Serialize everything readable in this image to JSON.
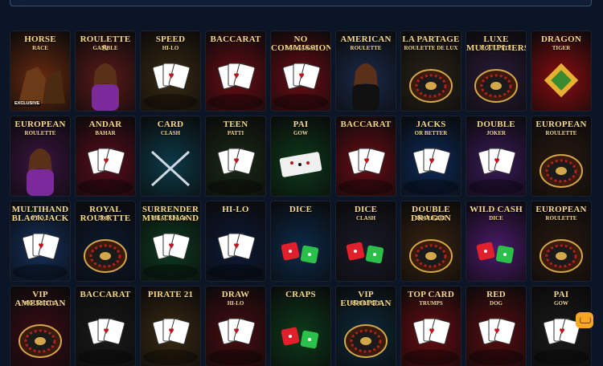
{
  "tiles": [
    {
      "title": "HORSE",
      "sub": "RACE",
      "bg": "#6a2a10",
      "badge": "EXCLUSIVE",
      "art": "horse"
    },
    {
      "title": "ROULETTE &",
      "sub": "GAMBLE",
      "bg": "#5a1a18",
      "art": "woman"
    },
    {
      "title": "SPEED",
      "sub": "HI-LO",
      "bg": "#3a2a12",
      "art": "cards"
    },
    {
      "title": "BACCARAT",
      "sub": "",
      "bg": "#6a0c14",
      "art": "cards"
    },
    {
      "title": "NO COMMISSION",
      "sub": "BACCARAT",
      "bg": "#6a0c14",
      "art": "cards"
    },
    {
      "title": "AMERICAN",
      "sub": "ROULETTE",
      "bg": "#1a2a4a",
      "art": "dealer"
    },
    {
      "title": "LA PARTAGE",
      "sub": "ROULETTE DE LUX",
      "bg": "#2a2418",
      "art": "wheel"
    },
    {
      "title": "LUXE MULTIPLIERS",
      "sub": "ROULETTE",
      "bg": "#2a1c38",
      "art": "wheel"
    },
    {
      "title": "DRAGON",
      "sub": "TIGER",
      "bg": "#8a0c10",
      "art": "diamond"
    },
    {
      "title": "EUROPEAN",
      "sub": "ROULETTE",
      "bg": "#3a1440",
      "art": "woman"
    },
    {
      "title": "ANDAR",
      "sub": "BAHAR",
      "bg": "#5a0c1c",
      "art": "cards"
    },
    {
      "title": "CARD",
      "sub": "CLASH",
      "bg": "#0c3a48",
      "art": "swords"
    },
    {
      "title": "TEEN",
      "sub": "PATTI",
      "bg": "#1a2a16",
      "art": "cards"
    },
    {
      "title": "PAI",
      "sub": "GOW",
      "bg": "#0c3a1a",
      "art": "tiles"
    },
    {
      "title": "BACCARAT",
      "sub": "",
      "bg": "#6a0c14",
      "art": "cards"
    },
    {
      "title": "JACKS",
      "sub": "OR BETTER",
      "bg": "#0c2a5a",
      "art": "cards"
    },
    {
      "title": "DOUBLE",
      "sub": "JOKER",
      "bg": "#3a1a5a",
      "art": "cards"
    },
    {
      "title": "EUROPEAN",
      "sub": "ROULETTE",
      "bg": "#2a1a10",
      "art": "wheel"
    },
    {
      "title": "MULTIHAND BLACKJACK",
      "sub": "PRO 2",
      "bg": "#14305a",
      "art": "cards"
    },
    {
      "title": "ROYAL ROULETTE",
      "sub": "500X",
      "bg": "#0c1a30",
      "art": "wheel"
    },
    {
      "title": "SURRENDER MULTIHAND",
      "sub": "BLACKJACK",
      "bg": "#0c3a20",
      "art": "cards"
    },
    {
      "title": "HI-LO",
      "sub": "",
      "bg": "#0c1a38",
      "art": "cards"
    },
    {
      "title": "DICE",
      "sub": "",
      "bg": "#0c2a4a",
      "art": "dice"
    },
    {
      "title": "DICE",
      "sub": "CLASH",
      "bg": "#1a1a2a",
      "art": "dice"
    },
    {
      "title": "DOUBLE DRAGON",
      "sub": "ROULETTE",
      "bg": "#3a2410",
      "art": "wheel"
    },
    {
      "title": "WILD CASH",
      "sub": "DICE",
      "bg": "#4a1a6a",
      "art": "dice"
    },
    {
      "title": "EUROPEAN",
      "sub": "ROULETTE",
      "bg": "#2a1a10",
      "art": "wheel"
    },
    {
      "title": "VIP AMERICAN",
      "sub": "ROULETTE",
      "bg": "#3a0c14",
      "art": "wheel"
    },
    {
      "title": "BACCARAT",
      "sub": "",
      "bg": "#1a1a1a",
      "art": "cards"
    },
    {
      "title": "PIRATE 21",
      "sub": "",
      "bg": "#3a2a12",
      "art": "cards"
    },
    {
      "title": "DRAW",
      "sub": "HI-LO",
      "bg": "#4a0c10",
      "art": "cards"
    },
    {
      "title": "CRAPS",
      "sub": "",
      "bg": "#0c3a1a",
      "art": "dice"
    },
    {
      "title": "VIP EUROPEAN",
      "sub": "ROULETTE",
      "bg": "#0c2a3a",
      "art": "wheel"
    },
    {
      "title": "TOP CARD",
      "sub": "TRUMPS",
      "bg": "#6a0c10",
      "art": "cards"
    },
    {
      "title": "RED",
      "sub": "DOG",
      "bg": "#5a0c10",
      "art": "cards"
    },
    {
      "title": "PAI",
      "sub": "GOW",
      "bg": "#1a1a1a",
      "art": "cards"
    }
  ]
}
